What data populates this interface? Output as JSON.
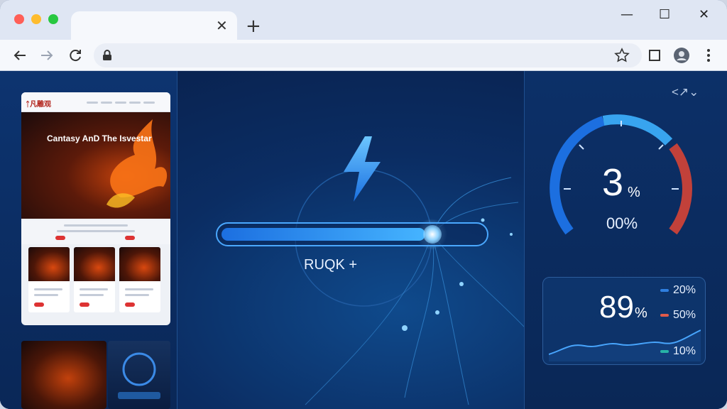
{
  "browser": {
    "tab_close_glyph": "✕",
    "new_tab_glyph": "+",
    "window_controls": {
      "minimize": "—",
      "maximize": "☐",
      "close": "✕"
    },
    "colors": {
      "close": "#ff5f57",
      "minimize": "#febc2e",
      "maximize": "#28c840"
    }
  },
  "toolbar": {
    "back_icon": "back-arrow-icon",
    "forward_icon": "forward-arrow-icon",
    "reload_icon": "reload-icon",
    "lock_icon": "lock-icon",
    "star_icon": "star-icon",
    "tab_icon": "tab-view-icon",
    "profile_icon": "profile-avatar-icon",
    "menu_icon": "more-vertical-icon"
  },
  "left_panel": {
    "main_thumbnail": {
      "site_name": "ᛏ凡雕观",
      "hero_title": "Cantasy AnD The Isvestar"
    }
  },
  "center": {
    "progress_label": "RUQK +",
    "progress_fraction": 0.78,
    "accent": "#45b4ff"
  },
  "right_panel": {
    "corner_controls": "<↗⌄",
    "gauge": {
      "value": "3",
      "unit": "%",
      "sub_label": "00%"
    },
    "stats": {
      "big_value": "89",
      "big_unit": "%",
      "legend": [
        {
          "label": "20%",
          "color": "#2f7fe0"
        },
        {
          "label": "50%",
          "color": "#e05a4a"
        },
        {
          "label": "10%",
          "color": "#27b3a7"
        }
      ]
    }
  }
}
